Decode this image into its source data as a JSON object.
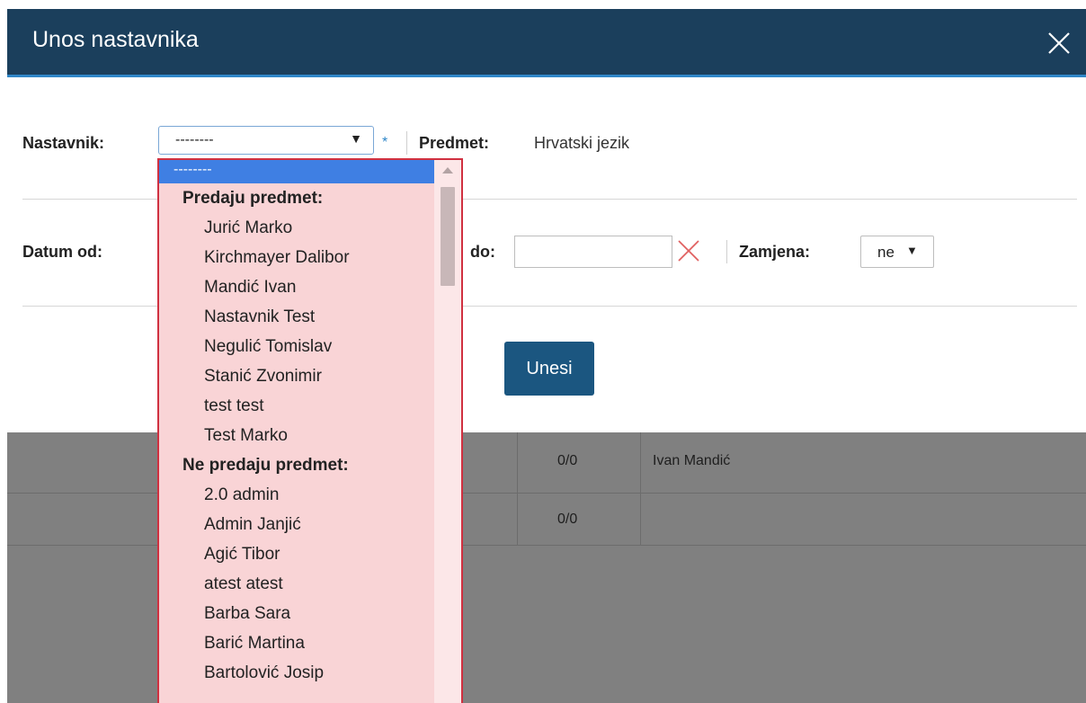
{
  "modal": {
    "title": "Unos nastavnika",
    "close_icon": "close-x-icon"
  },
  "form": {
    "nastavnik_label": "Nastavnik:",
    "nastavnik_value": "--------",
    "required_mark": "*",
    "predmet_label": "Predmet:",
    "predmet_value": "Hrvatski jezik",
    "datum_od_label": "Datum od:",
    "datum_do_label": "do:",
    "datum_do_value": "",
    "clear_icon": "clear-x-icon",
    "zamjena_label": "Zamjena:",
    "zamjena_value": "ne",
    "submit_label": "Unesi"
  },
  "dropdown": {
    "selected": "--------",
    "groups": [
      {
        "label": "Predaju predmet:",
        "items": [
          "Jurić Marko",
          "Kirchmayer Dalibor",
          "Mandić Ivan",
          "Nastavnik Test",
          "Negulić Tomislav",
          "Stanić Zvonimir",
          "test test",
          "Test Marko"
        ]
      },
      {
        "label": "Ne predaju predmet:",
        "items": [
          "2.0 admin",
          "Admin Janjić",
          "Agić Tibor",
          "atest atest",
          "Barba Sara",
          "Barić Martina",
          "Bartolović Josip"
        ]
      }
    ]
  },
  "background_table": {
    "rows": [
      {
        "count": "0/0",
        "name": "Ivan Mandić"
      },
      {
        "count": "0/0",
        "name": ""
      }
    ]
  },
  "colors": {
    "header_bg": "#1b3f5c",
    "accent": "#2f86c8",
    "button_bg": "#1b5680",
    "dropdown_bg": "#f9d4d6",
    "dropdown_border": "#d03040",
    "selected_bg": "#3f7fe3",
    "overlay": "#808080"
  }
}
